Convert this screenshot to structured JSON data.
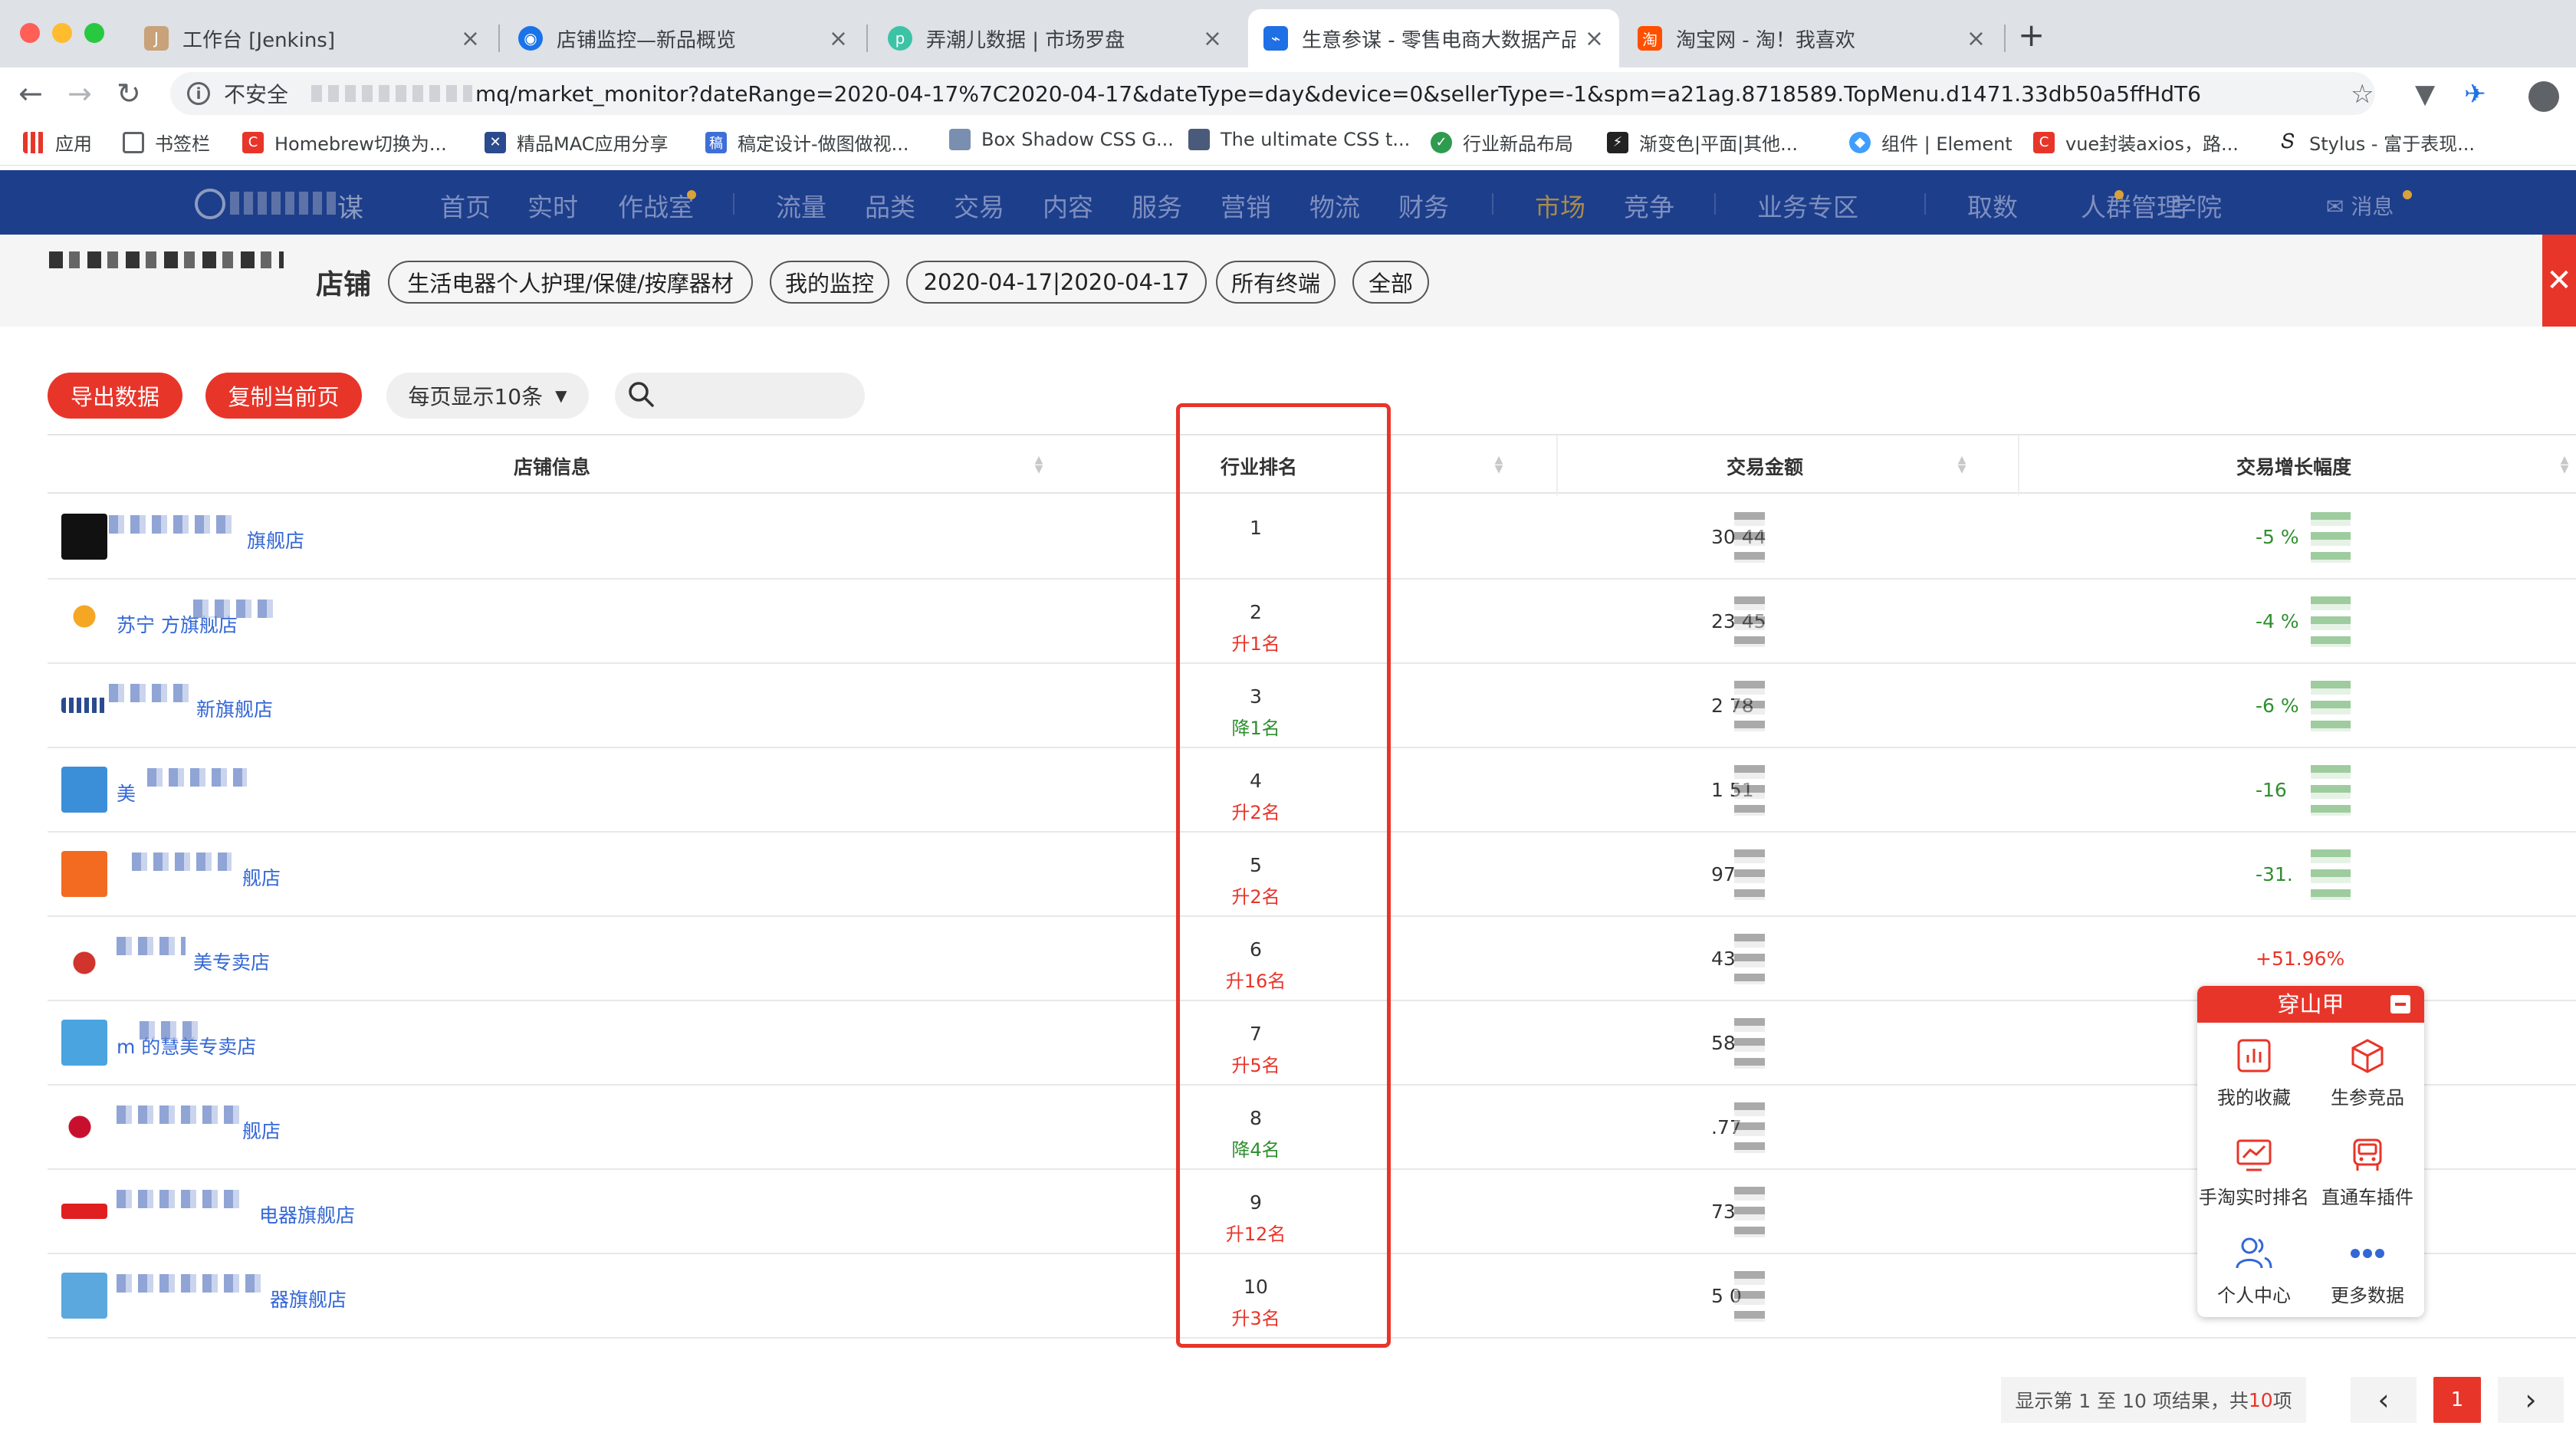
{
  "browser": {
    "tabs": [
      {
        "title": "工作台 [Jenkins]",
        "active": false
      },
      {
        "title": "店铺监控—新品概览",
        "active": false
      },
      {
        "title": "弄潮儿数据 | 市场罗盘",
        "active": false
      },
      {
        "title": "生意参谋 - 零售电商大数据产品",
        "active": true
      },
      {
        "title": "淘宝网 - 淘！我喜欢",
        "active": false
      }
    ],
    "security_label": "不安全",
    "url": "mq/market_monitor?dateRange=2020-04-17%7C2020-04-17&dateType=day&device=0&sellerType=-1&spm=a21ag.8718589.TopMenu.d1471.33db50a5ffHdT6",
    "bookmarks": [
      {
        "label": "应用"
      },
      {
        "label": "书签栏"
      },
      {
        "label": "Homebrew切换为..."
      },
      {
        "label": "精品MAC应用分享"
      },
      {
        "label": "稿定设计-做图做视..."
      },
      {
        "label": "Box Shadow CSS G..."
      },
      {
        "label": "The ultimate CSS t..."
      },
      {
        "label": "行业新品布局"
      },
      {
        "label": "渐变色|平面|其他..."
      },
      {
        "label": "组件 | Element"
      },
      {
        "label": "vue封装axios，路..."
      },
      {
        "label": "Stylus - 富于表现..."
      }
    ]
  },
  "app_nav": {
    "logo_suffix": "谋",
    "items": [
      "首页",
      "实时",
      "作战室",
      "流量",
      "品类",
      "交易",
      "内容",
      "服务",
      "营销",
      "物流",
      "财务",
      "市场",
      "竞争",
      "业务专区",
      "取数",
      "人群管理",
      "学院"
    ],
    "active_item": "市场",
    "message_label": "消息"
  },
  "filter": {
    "label": "店铺",
    "pills": [
      "生活电器个人护理/保健/按摩器材",
      "我的监控",
      "2020-04-17|2020-04-17",
      "所有终端",
      "全部"
    ]
  },
  "table_toolbar": {
    "export_label": "导出数据",
    "copy_label": "复制当前页",
    "page_size_label": "每页显示10条",
    "search_placeholder": ""
  },
  "table": {
    "columns": [
      "店铺信息",
      "行业排名",
      "交易金额",
      "交易增长幅度"
    ],
    "rows": [
      {
        "shop": "旗舰店",
        "rank": "1",
        "change": "",
        "dir": "",
        "amount": "30    44",
        "growth": "-5     %",
        "growth_dir": "down"
      },
      {
        "shop": "苏宁        方旗舰店",
        "rank": "2",
        "change": "升1名",
        "dir": "up",
        "amount": "23    45",
        "growth": "-4     %",
        "growth_dir": "down"
      },
      {
        "shop": "新旗舰店",
        "rank": "3",
        "change": "降1名",
        "dir": "down",
        "amount": "2     78",
        "growth": "-6     %",
        "growth_dir": "down"
      },
      {
        "shop": "美",
        "rank": "4",
        "change": "升2名",
        "dir": "up",
        "amount": "1     51",
        "growth": "-16    ",
        "growth_dir": "down"
      },
      {
        "shop": "舰店",
        "rank": "5",
        "change": "升2名",
        "dir": "up",
        "amount": "     97",
        "growth": "-31.",
        "growth_dir": "down"
      },
      {
        "shop": "美专卖店",
        "rank": "6",
        "change": "升16名",
        "dir": "up",
        "amount": "     43",
        "growth": "+51.96%",
        "growth_dir": "up"
      },
      {
        "shop": "m      的慧美专卖店",
        "rank": "7",
        "change": "升5名",
        "dir": "up",
        "amount": "     58",
        "growth": "",
        "growth_dir": ""
      },
      {
        "shop": "舰店",
        "rank": "8",
        "change": "降4名",
        "dir": "down",
        "amount": "    .77",
        "growth": "",
        "growth_dir": ""
      },
      {
        "shop": "电器旗舰店",
        "rank": "9",
        "change": "升12名",
        "dir": "up",
        "amount": "     73",
        "growth": "",
        "growth_dir": ""
      },
      {
        "shop": "器旗舰店",
        "rank": "10",
        "change": "升3名",
        "dir": "up",
        "amount": "5     0",
        "growth": "",
        "growth_dir": ""
      }
    ]
  },
  "plugin": {
    "title": "穿山甲",
    "items": [
      {
        "label": "我的收藏",
        "icon": "bar-chart-icon"
      },
      {
        "label": "生参竞品",
        "icon": "cube-icon"
      },
      {
        "label": "手淘实时排名",
        "icon": "monitor-chart-icon"
      },
      {
        "label": "直通车插件",
        "icon": "car-icon"
      },
      {
        "label": "个人中心",
        "icon": "users-icon"
      },
      {
        "label": "更多数据",
        "icon": "more-icon"
      }
    ]
  },
  "pagination": {
    "info_prefix": "显示第 1 至 10 项结果，共 ",
    "info_total": "10",
    "info_suffix": " 项",
    "current_page": "1"
  },
  "colors": {
    "accent": "#e8352a",
    "nav_bg": "#1d3e8a",
    "link": "#3367d6",
    "positive": "#2f8f2f"
  }
}
